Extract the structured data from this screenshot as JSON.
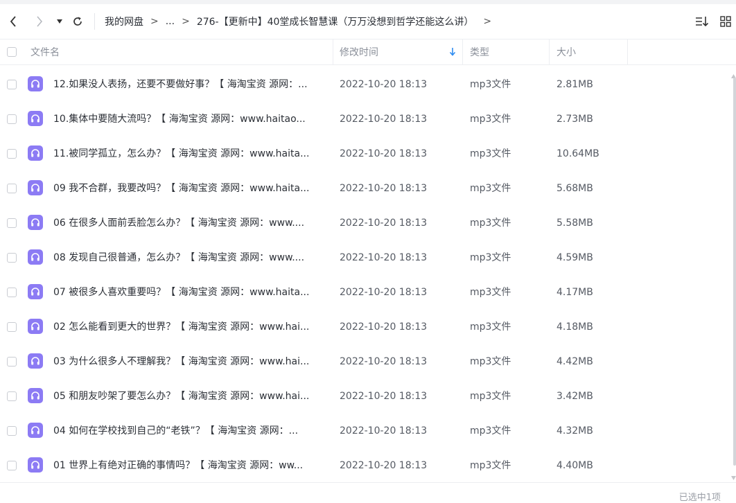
{
  "toolbar": {
    "back_icon": "chevron-left-icon",
    "forward_icon": "chevron-right-icon",
    "history_icon": "caret-down-icon",
    "refresh_icon": "refresh-icon",
    "sort_icon": "sort-list-icon",
    "view_icon": "grid-view-icon"
  },
  "breadcrumb": {
    "root": "我的网盘",
    "separator": ">",
    "ellipsis": "...",
    "current": "276-【更新中】40堂成长智慧课（万万没想到哲学还能这么讲）",
    "trailing": ">"
  },
  "columns": {
    "name": "文件名",
    "modified": "修改时间",
    "type": "类型",
    "size": "大小",
    "sort_indicator": "arrow-down-icon"
  },
  "files": [
    {
      "name": "12.如果没人表扬，还要不要做好事？【 海淘宝资 源网：...",
      "modified": "2022-10-20 18:13",
      "type": "mp3文件",
      "size": "2.81MB"
    },
    {
      "name": "10.集体中要随大流吗？【 海淘宝资 源网：www.haitao...",
      "modified": "2022-10-20 18:13",
      "type": "mp3文件",
      "size": "2.73MB"
    },
    {
      "name": "11.被同学孤立，怎么办？【 海淘宝资 源网：www.haita...",
      "modified": "2022-10-20 18:13",
      "type": "mp3文件",
      "size": "10.64MB"
    },
    {
      "name": "09 我不合群，我要改吗？【 海淘宝资 源网：www.haita...",
      "modified": "2022-10-20 18:13",
      "type": "mp3文件",
      "size": "5.68MB"
    },
    {
      "name": "06 在很多人面前丢脸怎么办？【 海淘宝资 源网：www....",
      "modified": "2022-10-20 18:13",
      "type": "mp3文件",
      "size": "5.58MB"
    },
    {
      "name": "08 发现自己很普通，怎么办？【 海淘宝资 源网：www....",
      "modified": "2022-10-20 18:13",
      "type": "mp3文件",
      "size": "4.59MB"
    },
    {
      "name": "07 被很多人喜欢重要吗？【 海淘宝资 源网：www.haita...",
      "modified": "2022-10-20 18:13",
      "type": "mp3文件",
      "size": "4.17MB"
    },
    {
      "name": "02 怎么能看到更大的世界？【 海淘宝资 源网：www.hai...",
      "modified": "2022-10-20 18:13",
      "type": "mp3文件",
      "size": "4.18MB"
    },
    {
      "name": "03 为什么很多人不理解我？【 海淘宝资 源网：www.hai...",
      "modified": "2022-10-20 18:13",
      "type": "mp3文件",
      "size": "4.42MB"
    },
    {
      "name": "05 和朋友吵架了要怎么办？【 海淘宝资 源网：www.hai...",
      "modified": "2022-10-20 18:13",
      "type": "mp3文件",
      "size": "3.42MB"
    },
    {
      "name": "04 如何在学校找到自己的“老铁”？【 海淘宝资 源网：...",
      "modified": "2022-10-20 18:13",
      "type": "mp3文件",
      "size": "4.32MB"
    },
    {
      "name": "01 世界上有绝对正确的事情吗？【 海淘宝资 源网：ww...",
      "modified": "2022-10-20 18:13",
      "type": "mp3文件",
      "size": "4.40MB"
    }
  ],
  "file_icon": "headphones-icon",
  "status": {
    "selection": "已选中1项"
  },
  "colors": {
    "audio_icon": "#8c7bf4",
    "sort_arrow": "#2f8cf0",
    "text": "#2b2f36",
    "muted": "#8a8f99"
  }
}
